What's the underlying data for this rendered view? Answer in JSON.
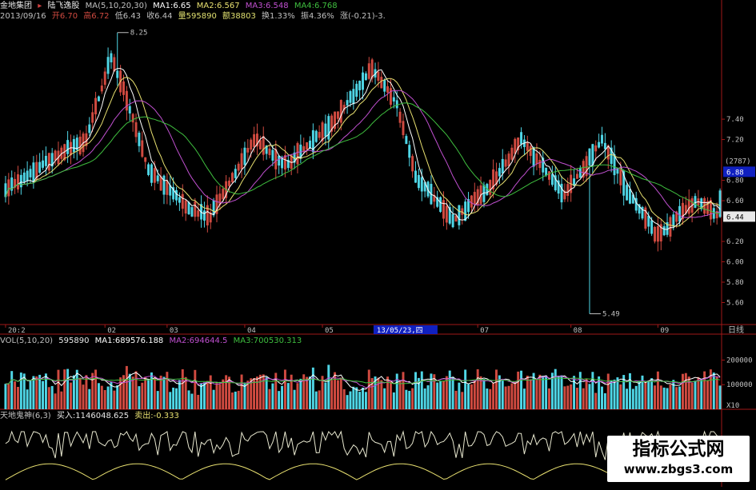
{
  "header": {
    "stock_name": "金地集团",
    "arrow": "▸",
    "indicator_name": "陆飞逸股",
    "ma_params": "MA(5,10,20,30)",
    "ma1": "MA1:6.65",
    "ma2": "MA2:6.567",
    "ma3": "MA3:6.548",
    "ma4": "MA4:6.768",
    "date": "2013/09/16",
    "open": "开6.70",
    "high": "高6.72",
    "low": "低6.43",
    "close": "收6.44",
    "volume": "量595890",
    "amount": "额38803",
    "turnover": "换1.33%",
    "amplitude": "振4.36%",
    "change": "涨(-0.21)-3."
  },
  "price_panel": {
    "high_marker": "8.25",
    "low_marker": "5.49",
    "current_price": "6.44",
    "crosshair_price": "6.88",
    "count_label": "(2787)",
    "axis_labels": [
      "7.40",
      "7.20",
      "6.80",
      "6.60",
      "6.20",
      "6.00",
      "5.80",
      "5.60"
    ],
    "x_labels": [
      "20:2",
      "02",
      "03",
      "04",
      "05",
      "06",
      "07",
      "08",
      "09"
    ],
    "cursor_date": "13/05/23,四",
    "period_label": "日线"
  },
  "volume_panel": {
    "title": "VOL(5,10,20)",
    "vol": "595890",
    "ma1": "MA1:689576.188",
    "ma2": "MA2:694644.5",
    "ma3": "MA3:700530.313",
    "axis_labels": [
      "200000",
      "100000"
    ],
    "unit": "X10"
  },
  "indicator_panel": {
    "title": "天地鬼神(6,3)",
    "buy": "买入:1146048.625",
    "sell": "卖出:-0.333"
  },
  "watermark": {
    "title": "指标公式网",
    "url": "www.zbgs3.com"
  },
  "colors": {
    "up": "#d04a40",
    "down": "#4fd6e6",
    "ma1": "#ffffff",
    "ma2": "#e8e070",
    "ma3": "#c050d0",
    "ma4": "#3fbf3f",
    "axis": "#a01818"
  },
  "chart_data": {
    "type": "candlestick",
    "ylim": [
      5.4,
      8.35
    ],
    "ma_periods": [
      5,
      10,
      20,
      30
    ],
    "period": "daily",
    "start_date": "2012-12-20",
    "end_date": "2013-09-16"
  }
}
